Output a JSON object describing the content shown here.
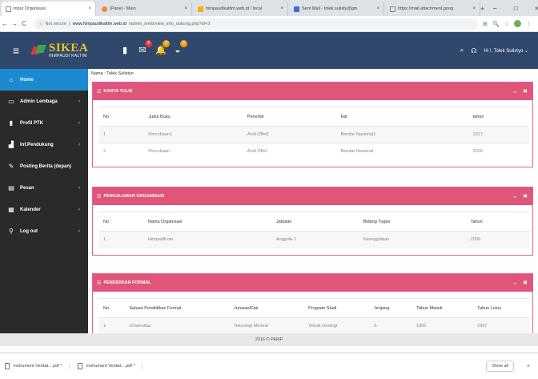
{
  "browser": {
    "tabs": [
      {
        "title": "Input Organisasi",
        "fav": "page"
      },
      {
        "title": "(Panel - Main",
        "fav": "orange"
      },
      {
        "title": "himpaudikaltim.web.id / local",
        "fav": "yellow"
      },
      {
        "title": "Sent Mail - tolek.sulisty@gm",
        "fav": "blue"
      },
      {
        "title": "https://mail.attachment.goog",
        "fav": "page"
      }
    ],
    "new_tab": "+",
    "window_controls": [
      "–",
      "□",
      "×"
    ],
    "nav": [
      "←",
      "→",
      "C"
    ],
    "url_secure": "Not secure",
    "url_host": "www.himpaudikaltim.web.id",
    "url_path": "/admin_lemb/view_info_dukung.php?id=3",
    "right_icons": [
      "⊞",
      "🔍",
      "☆"
    ]
  },
  "header": {
    "menu_icon": "≡",
    "logo_text": "SIKEA",
    "logo_sub": "HIMPAUDI KALTIM",
    "icons": [
      {
        "name": "document-icon",
        "glyph": "▮",
        "badge": ""
      },
      {
        "name": "mail-icon",
        "glyph": "✉",
        "badge": "2",
        "badge_color": "red"
      },
      {
        "name": "bell-icon",
        "glyph": "🔔",
        "badge": "4",
        "badge_color": "orange"
      },
      {
        "name": "tag-icon",
        "glyph": "◒",
        "badge": "3",
        "badge_color": "orange"
      }
    ],
    "search_icon": "⌕",
    "support_icon": "☊",
    "user": "Hi !, Tolek Sulistyo ⌄"
  },
  "sidebar": {
    "items": [
      {
        "label": "Home",
        "icon": "⌂",
        "active": true,
        "arrow": ""
      },
      {
        "label": "Admin Lembaga",
        "icon": "▭",
        "active": false,
        "arrow": "‹"
      },
      {
        "label": "Profil PTK",
        "icon": "▮",
        "active": false,
        "arrow": "‹"
      },
      {
        "label": "Inf.Pendukung",
        "icon": "▟",
        "active": false,
        "arrow": "‹"
      },
      {
        "label": "Posting Berita (depan)",
        "icon": "✎",
        "active": false,
        "arrow": ""
      },
      {
        "label": "Pesan",
        "icon": "▤",
        "active": false,
        "arrow": "‹"
      },
      {
        "label": "Kalender",
        "icon": "▦",
        "active": false,
        "arrow": "‹"
      },
      {
        "label": "Log out",
        "icon": "⚲",
        "active": false,
        "arrow": "‹"
      }
    ]
  },
  "main": {
    "breadcrumb": "Nama : Tolek Sulistyo",
    "karya": {
      "title": "KARYA TULIS",
      "headers": [
        "No",
        "Judul Buku",
        "Penerbit",
        "Kat",
        "tahun"
      ],
      "rows": [
        [
          "1",
          "Percobaan1",
          "Andi Offet1",
          "Bendar Nasional1",
          "2017"
        ],
        [
          "2",
          "Percobaan",
          "Andi Offet",
          "Bendar Nasional",
          "2018"
        ]
      ]
    },
    "organisasi": {
      "title": "PENGALAMAN ORGANISASI",
      "headers": [
        "No",
        "Nama Organisasi",
        "Jabatan",
        "Bidang Tugas",
        "Tahun"
      ],
      "rows": [
        [
          "1",
          "HimpadiKota",
          "Anggota 1",
          "Keanggotaan",
          "2000"
        ]
      ]
    },
    "pendidikan": {
      "title": "PENDIDIKAN FORMAL",
      "headers": [
        "No",
        "Satuan Pendidikan Formal",
        "Jurusan/Fak.",
        "Program Studi",
        "Jenjang",
        "Tahun Masuk",
        "Tahun Lulus"
      ],
      "rows": [
        [
          "1",
          "Universitas",
          "Teknologi Mineral",
          "Teknik Geologi",
          "S",
          "1992",
          "1997"
        ]
      ]
    },
    "panel_controls": [
      "⌄",
      "✖"
    ]
  },
  "footer": {
    "text": "2016 © PAMP"
  },
  "downloads": {
    "items": [
      "instrument Verdat....pdf ^",
      "instrument Verdat....pdf ^"
    ],
    "show_all": "Show all",
    "close": "×"
  }
}
